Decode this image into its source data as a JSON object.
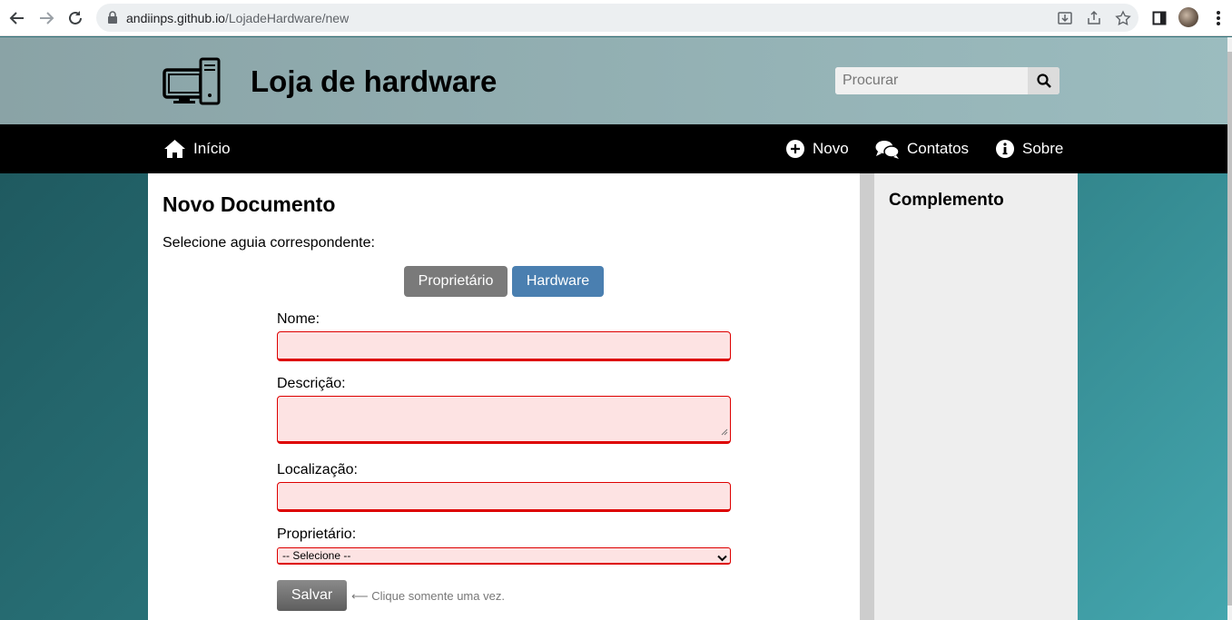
{
  "browser": {
    "url_host": "andiinps.github.io",
    "url_path": "/LojadeHardware/new"
  },
  "site": {
    "title": "Loja de hardware",
    "search_placeholder": "Procurar"
  },
  "nav": {
    "home": "Início",
    "new": "Novo",
    "contacts": "Contatos",
    "about": "Sobre"
  },
  "main": {
    "title": "Novo Documento",
    "instruction": "Selecione aguia correspondente:",
    "tabs": {
      "owner": "Proprietário",
      "hardware": "Hardware"
    },
    "form": {
      "name_label": "Nome:",
      "name_value": "",
      "description_label": "Descrição:",
      "description_value": "",
      "location_label": "Localização:",
      "location_value": "",
      "owner_label": "Proprietário:",
      "owner_selected": "-- Selecione --",
      "save_label": "Salvar",
      "save_hint": "⟵ Clique somente uma vez."
    }
  },
  "aside": {
    "title": "Complemento"
  },
  "colors": {
    "header_bg": "#8aa3a6",
    "nav_bg": "#000000",
    "tab_owner": "#7a7a7a",
    "tab_hardware": "#4a7fb0",
    "invalid_field_bg": "#fde3e3",
    "invalid_field_border": "#dd0000"
  }
}
